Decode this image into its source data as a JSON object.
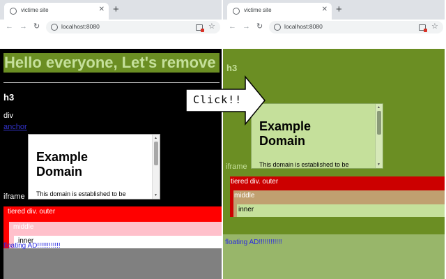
{
  "browser": {
    "tab_title": "victime site",
    "tab_close": "✕",
    "new_tab": "+",
    "back": "←",
    "forward": "→",
    "reload": "↻",
    "url": "localhost:8080",
    "star": "☆"
  },
  "page": {
    "headline": "Hello everyone, Let's remove",
    "h3": "h3",
    "div_text": "div",
    "anchor": "anchor",
    "iframe_label": "iframe",
    "iframe": {
      "title_line1": "Example",
      "title_line2": "Domain",
      "text": "This domain is established to be",
      "scroll_up": "▲",
      "scroll_down": "▼"
    },
    "tiered_outer": "tiered div. outer",
    "tiered_middle": "middle",
    "tiered_inner": "inner",
    "floating": "floating AD!!!!!!!!!!!!"
  },
  "callout": {
    "text": "Click!!"
  },
  "colors": {
    "left_background": "#000000",
    "right_background": "#6b8e23",
    "headline_bg": "#6b8e23",
    "headline_text": "#c5e09b",
    "left_outer": "#ff0000",
    "left_middle": "#ffc0cb",
    "left_inner": "#ffffff",
    "left_floating_bg": "#808080",
    "right_iframe_bg": "#c5e09b",
    "right_outer": "#cc0000",
    "right_middle": "#c0a070",
    "right_inner": "#c5e09b",
    "right_floating_bg": "#98b66a"
  }
}
